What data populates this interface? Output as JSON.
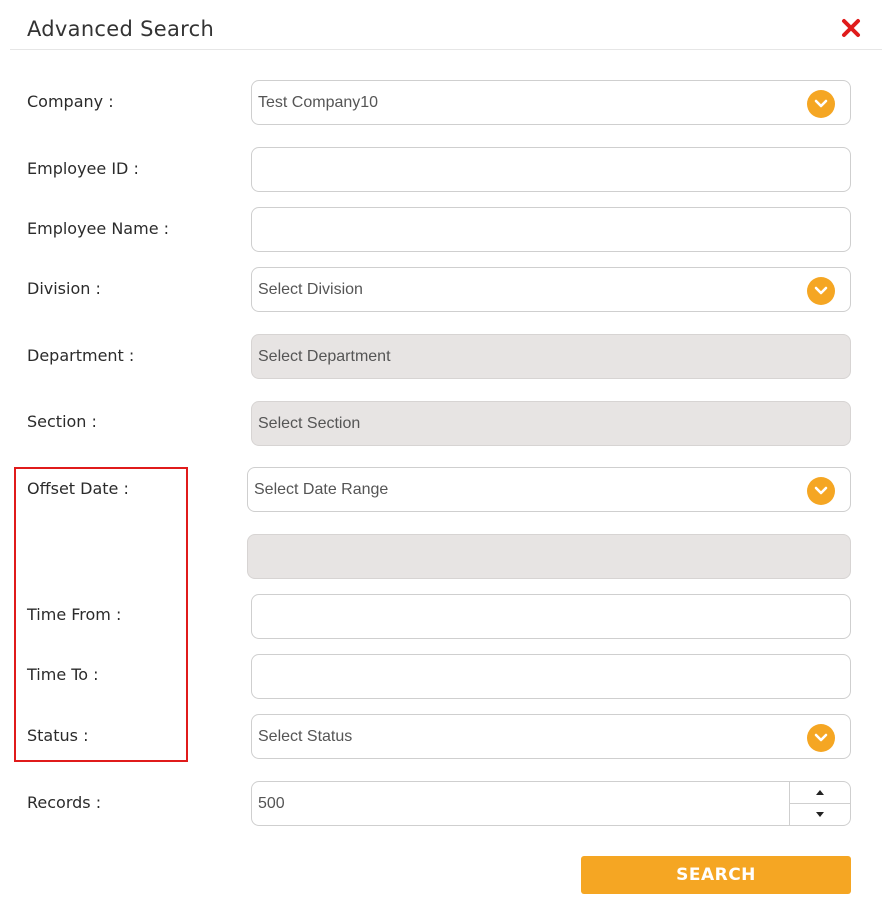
{
  "dialog": {
    "title": "Advanced Search",
    "close_icon": "close-icon",
    "close_color": "#e01b1b"
  },
  "labels": {
    "company": "Company :",
    "employee_id": "Employee ID :",
    "employee_name": "Employee Name :",
    "division": "Division :",
    "department": "Department :",
    "section": "Section :",
    "offset_date": "Offset Date :",
    "time_from": "Time From :",
    "time_to": "Time To :",
    "status": "Status :",
    "records": "Records :"
  },
  "fields": {
    "company": "Test Company10",
    "employee_id": "",
    "employee_name": "",
    "division": "Select Division",
    "department": "Select Department",
    "section": "Select Section",
    "date_range": "Select Date Range",
    "date_value": "",
    "time_from": "",
    "time_to": "",
    "status": "Select Status",
    "records": "500"
  },
  "buttons": {
    "search": "SEARCH"
  },
  "colors": {
    "accent": "#f5a623",
    "highlight_box": "#e01b1b",
    "disabled_bg": "#e7e4e3"
  }
}
